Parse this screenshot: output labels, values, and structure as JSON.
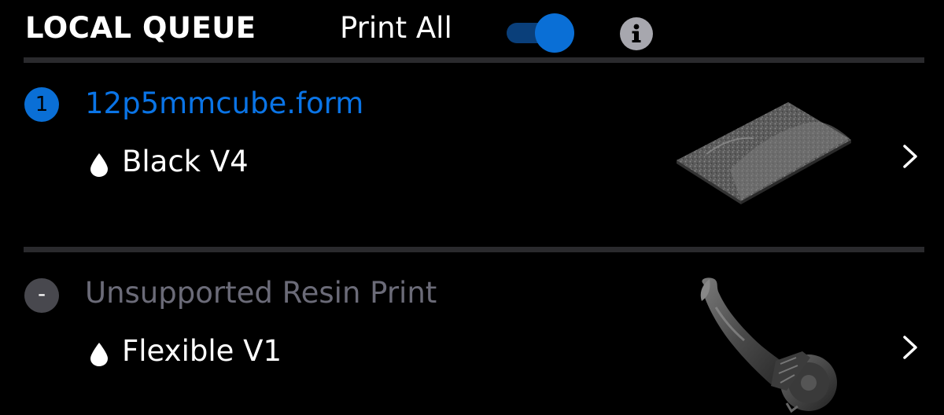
{
  "header": {
    "title": "LOCAL QUEUE",
    "print_all_label": "Print All",
    "print_all_enabled": true
  },
  "queue": [
    {
      "position": "1",
      "name": "12p5mmcube.form",
      "resin": "Black V4",
      "status": "active",
      "thumbnail": "textured-plate-model"
    },
    {
      "position": "-",
      "name": "Unsupported Resin Print",
      "resin": "Flexible V1",
      "status": "unsupported",
      "thumbnail": "figure-model"
    }
  ],
  "colors": {
    "background": "#000000",
    "accent": "#0a6fd6",
    "toggle_track": "#0a3f7a",
    "info_icon": "#a7a7ae",
    "divider": "#2a2a2d",
    "muted_text": "#6b6b78",
    "unsupported_badge": "#48484e"
  },
  "icons": {
    "info": "info-icon",
    "resin": "droplet-icon",
    "chevron": "chevron-right-icon"
  }
}
